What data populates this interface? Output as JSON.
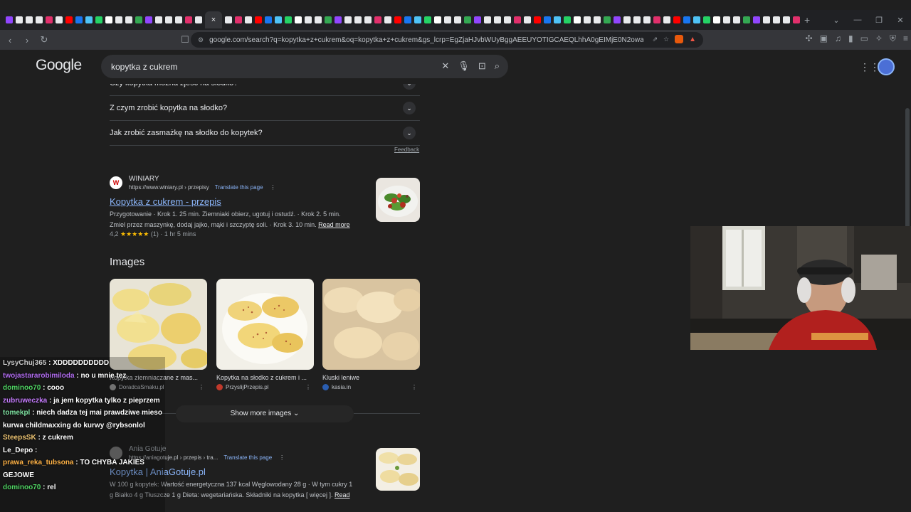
{
  "browser": {
    "tab_close": "×",
    "new_tab": "+",
    "url": "google.com/search?q=kopytka+z+cukrem&oq=kopytka+z+cukrem&gs_lcrp=EgZjaHJvbWUyBggAEEUYOTIGCAEQLhhA0gEIMjE0N2owajSoAgCwAgE..."
  },
  "header": {
    "logo": "Google",
    "search_value": "kopytka z cukrem"
  },
  "paa": {
    "items": [
      "Czy kopytka można zjeść na słodko?",
      "Z czym zrobić kopytka na słodko?",
      "Jak zrobić zasmażkę na słodko do kopytek?"
    ],
    "feedback": "Feedback"
  },
  "result1": {
    "site_name": "WINIARY",
    "site_url": "https://www.winiary.pl › przepisy",
    "translate": "Translate this page",
    "title": "Kopytka z cukrem - przepis",
    "snippet_1": "Przygotowanie · Krok 1. 25 min. Ziemniaki obierz, ugotuj i ostudź. · Krok 2. 5 min.",
    "snippet_2": "Zmiel przez maszynkę, dodaj jajko, mąki i szczyptę soli. · Krok 3. 10 min.",
    "read_more": "Read more",
    "rating_value": "4,2",
    "stars": "★★★★★",
    "rating_meta": "(1) · 1 hr 5 mins"
  },
  "images": {
    "heading": "Images",
    "cards": [
      {
        "caption": "Kopytka ziemniaczane z mas...",
        "source": "DoradcaSmaku.pl"
      },
      {
        "caption": "Kopytka na słodko z cukrem i ...",
        "source": "PrzyslijPrzepis.pl"
      },
      {
        "caption": "Kluski leniwe",
        "source": "kasia.in"
      }
    ],
    "show_more": "Show more images"
  },
  "result2": {
    "site_name": "Ania Gotuje",
    "site_url": "https://aniagotuje.pl › przepis › tra...",
    "translate": "Translate this page",
    "title": "Kopytka | AniaGotuje.pl",
    "snippet_1": "W 100 g kopytek: Wartość energetyczna 137 kcal Węglowodany 28 g · W tym cukry 1",
    "snippet_2": "g Białko 4 g Tłuszcze 1 g Dieta: wegetariańska. Składniki na kopytka [ więcej ].",
    "read_more": "Read"
  },
  "chat": [
    {
      "user": "LysyChuj365",
      "msg": "XDDDDDDDDDD",
      "color": "#c9c9c9"
    },
    {
      "user": "twojastararobimiloda",
      "msg": "no u mnie tez",
      "color": "#b16cf0"
    },
    {
      "user": "dominoo70",
      "msg": "cooo",
      "color": "#4fd463"
    },
    {
      "user": "zubruweczka",
      "msg": "ja jem kopytka tylko z pieprzem",
      "color": "#c77dff"
    },
    {
      "user": "tomekpl",
      "msg": "niech dadza tej mai prawdziwe mieso kurwa childmaxxing do kurwy @rybsonlol",
      "color": "#7ee0a0"
    },
    {
      "user": "SteepsSK",
      "msg": "z cukrem",
      "color": "#f0c674"
    },
    {
      "user": "Le_Depo",
      "msg": "",
      "color": "#ffffff"
    },
    {
      "user": "prawa_reka_tubsona",
      "msg": "TO CHYBA JAKIES GEJOWE",
      "color": "#ffb347"
    },
    {
      "user": "dominoo70",
      "msg": "rel",
      "color": "#4fd463"
    }
  ]
}
